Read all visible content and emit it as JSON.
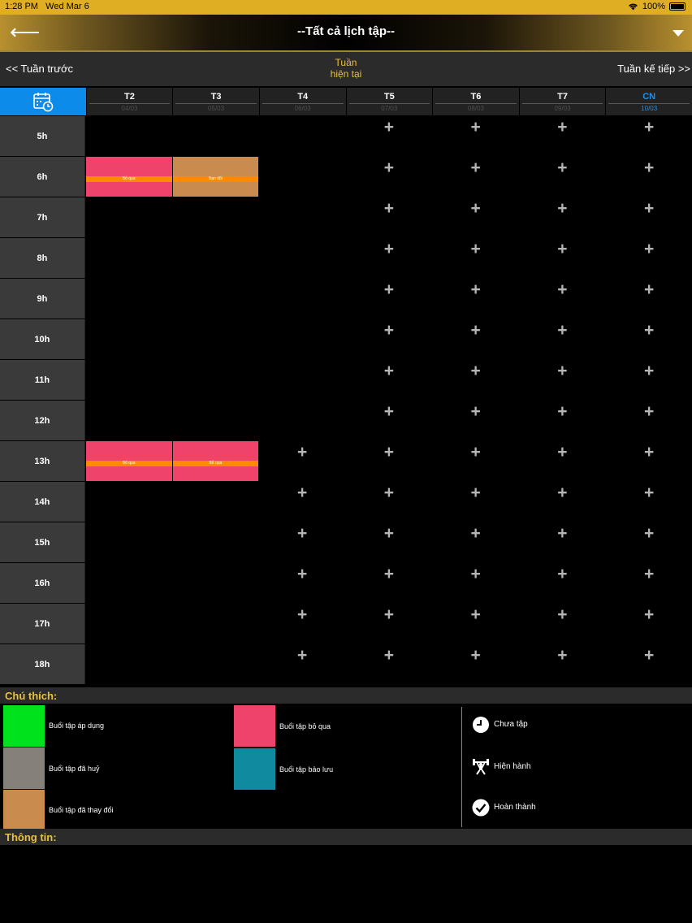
{
  "status_bar": {
    "time": "1:28 PM",
    "date": "Wed Mar 6",
    "battery": "100%"
  },
  "header": {
    "title": "--Tất cả lịch tập--"
  },
  "week_nav": {
    "prev": "<< Tuần trước",
    "current_line1": "Tuần",
    "current_line2": "hiện tại",
    "next": "Tuần kế tiếp >>"
  },
  "days": [
    {
      "name": "T2",
      "date": "04/03"
    },
    {
      "name": "T3",
      "date": "05/03"
    },
    {
      "name": "T4",
      "date": "06/03"
    },
    {
      "name": "T5",
      "date": "07/03"
    },
    {
      "name": "T6",
      "date": "08/03"
    },
    {
      "name": "T7",
      "date": "09/03"
    },
    {
      "name": "CN",
      "date": "10/03"
    }
  ],
  "today_index": 6,
  "hours": [
    "5h",
    "6h",
    "7h",
    "8h",
    "9h",
    "10h",
    "11h",
    "12h",
    "13h",
    "14h",
    "15h",
    "16h",
    "17h",
    "18h"
  ],
  "add_symbol": "+",
  "sessions": [
    {
      "hour": "6h",
      "day": 0,
      "label": "Bỏ qua",
      "color": "#f0436c"
    },
    {
      "hour": "6h",
      "day": 1,
      "label": "Bạn đổi",
      "color": "#c98c4e"
    },
    {
      "hour": "13h",
      "day": 0,
      "label": "Bỏ qua",
      "color": "#f0436c"
    },
    {
      "hour": "13h",
      "day": 1,
      "label": "Bỏ qua",
      "color": "#f0436c"
    }
  ],
  "addable_from": {
    "5h": 3,
    "6h": 3,
    "7h": 3,
    "8h": 3,
    "9h": 3,
    "10h": 3,
    "11h": 3,
    "12h": 3,
    "13h": 2,
    "14h": 2,
    "15h": 2,
    "16h": 2,
    "17h": 2,
    "18h": 2
  },
  "legend": {
    "title": "Chú thích:",
    "items": [
      {
        "label": "Buổi tập áp dụng",
        "color": "#00e21c"
      },
      {
        "label": "Buổi tập đã huỷ",
        "color": "#858079"
      },
      {
        "label": "Buổi tập đã thay đổi",
        "color": "#c98c4e"
      },
      {
        "label": "Buổi tập bỏ qua",
        "color": "#f0436c"
      },
      {
        "label": "Buổi tập bảo lưu",
        "color": "#0f8a9e"
      }
    ],
    "status": [
      {
        "icon": "clock-icon",
        "label": "Chưa tập"
      },
      {
        "icon": "weightlifter-icon",
        "label": "Hiện hành"
      },
      {
        "icon": "check-circle-icon",
        "label": "Hoàn thành"
      }
    ]
  },
  "info": {
    "title": "Thông tin:"
  }
}
